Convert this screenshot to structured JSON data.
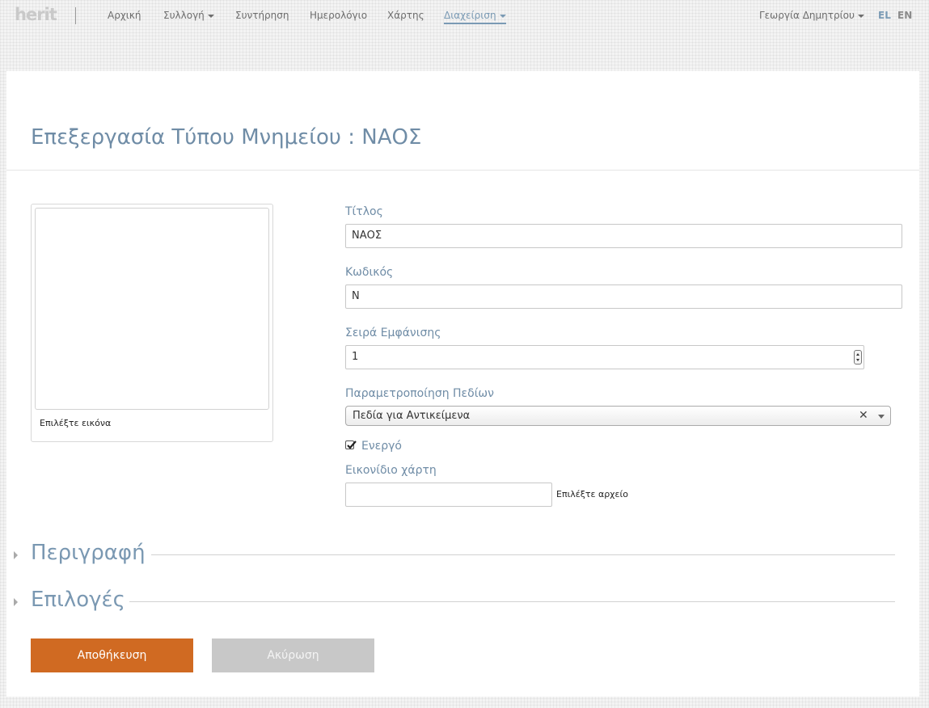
{
  "navbar": {
    "logo": "herit",
    "items": [
      {
        "label": "Αρχική",
        "has_caret": false
      },
      {
        "label": "Συλλογή",
        "has_caret": true
      },
      {
        "label": "Συντήρηση",
        "has_caret": false
      },
      {
        "label": "Ημερολόγιο",
        "has_caret": false
      },
      {
        "label": "Χάρτης",
        "has_caret": false
      },
      {
        "label": "Διαχείριση",
        "has_caret": true,
        "active": true
      }
    ],
    "user": "Γεωργία Δημητρίου",
    "languages": [
      {
        "code": "EL",
        "active": true
      },
      {
        "code": "EN",
        "active": false
      }
    ]
  },
  "page": {
    "title": "Επεξεργασία Τύπου Μνημείου : ΝΑΟΣ"
  },
  "image_panel": {
    "caption": "Επιλέξτε εικόνα"
  },
  "form": {
    "title_label": "Τίτλος",
    "title_value": "ΝΑΟΣ",
    "code_label": "Κωδικός",
    "code_value": "N",
    "order_label": "Σειρά Εμφάνισης",
    "order_value": "1",
    "fields_label": "Παραμετροποίηση Πεδίων",
    "fields_value": "Πεδία για Αντικείμενα",
    "active_label": "Ενεργό",
    "active_checked": true,
    "map_icon_label": "Εικονίδιο χάρτη",
    "file_button": "Επιλέξτε αρχείο"
  },
  "sections": {
    "description": "Περιγραφή",
    "options": "Επιλογές"
  },
  "buttons": {
    "save": "Αποθήκευση",
    "cancel": "Ακύρωση"
  },
  "colors": {
    "accent_blue": "#6f8ca6",
    "save_orange": "#d06a22",
    "cancel_grey": "#c8c8c8"
  }
}
